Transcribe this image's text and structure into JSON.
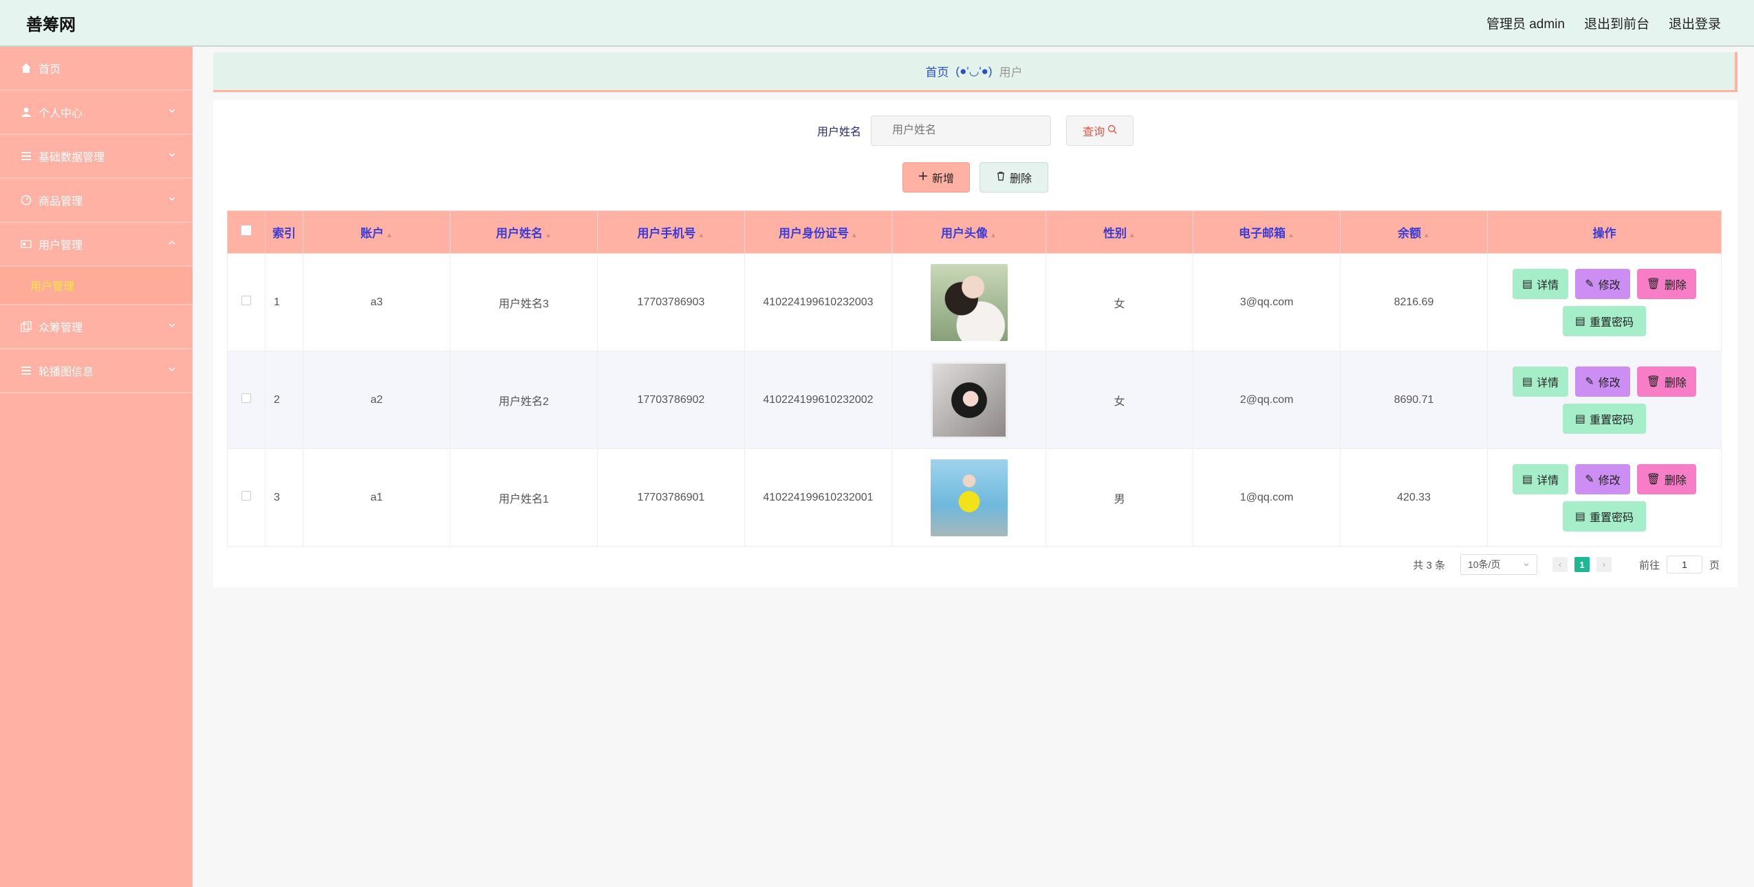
{
  "header": {
    "brand": "善筹网",
    "admin_label": "管理员 admin",
    "front_link": "退出到前台",
    "logout_link": "退出登录"
  },
  "sidebar": {
    "items": [
      {
        "label": "首页",
        "icon": "home-icon"
      },
      {
        "label": "个人中心",
        "icon": "user-icon"
      },
      {
        "label": "基础数据管理",
        "icon": "list-icon"
      },
      {
        "label": "商品管理",
        "icon": "gauge-icon"
      },
      {
        "label": "用户管理",
        "icon": "card-icon"
      },
      {
        "label": "众筹管理",
        "icon": "copy-icon"
      },
      {
        "label": "轮播图信息",
        "icon": "list-icon"
      }
    ],
    "sub_active": "用户管理"
  },
  "breadcrumb": {
    "home": "首页",
    "face": "(●'◡'●)",
    "current": "用户"
  },
  "search": {
    "label": "用户姓名",
    "placeholder": "用户姓名",
    "button": "查询"
  },
  "actions": {
    "add": "新增",
    "delete": "删除"
  },
  "table": {
    "columns": [
      "索引",
      "账户",
      "用户姓名",
      "用户手机号",
      "用户身份证号",
      "用户头像",
      "性别",
      "电子邮箱",
      "余额",
      "操作"
    ],
    "rows": [
      {
        "index": "1",
        "account": "a3",
        "name": "用户姓名3",
        "phone": "17703786903",
        "id_card": "410224199610232003",
        "gender": "女",
        "email": "3@qq.com",
        "balance": "8216.69"
      },
      {
        "index": "2",
        "account": "a2",
        "name": "用户姓名2",
        "phone": "17703786902",
        "id_card": "410224199610232002",
        "gender": "女",
        "email": "2@qq.com",
        "balance": "8690.71"
      },
      {
        "index": "3",
        "account": "a1",
        "name": "用户姓名1",
        "phone": "17703786901",
        "id_card": "410224199610232001",
        "gender": "男",
        "email": "1@qq.com",
        "balance": "420.33"
      }
    ],
    "row_actions": {
      "detail": "详情",
      "edit": "修改",
      "delete": "删除",
      "reset": "重置密码"
    }
  },
  "pagination": {
    "total": "共 3 条",
    "page_size": "10条/页",
    "current_page": "1",
    "goto_prefix": "前往",
    "goto_value": "1",
    "goto_suffix": "页"
  },
  "colors": {
    "sidebar_bg": "#ffb2a3",
    "header_bg": "#e6f4ef",
    "accent_active": "#1fb894",
    "detail_btn": "#a6edc9",
    "edit_btn": "#cc8ef3",
    "delete_btn": "#f77dc7"
  }
}
